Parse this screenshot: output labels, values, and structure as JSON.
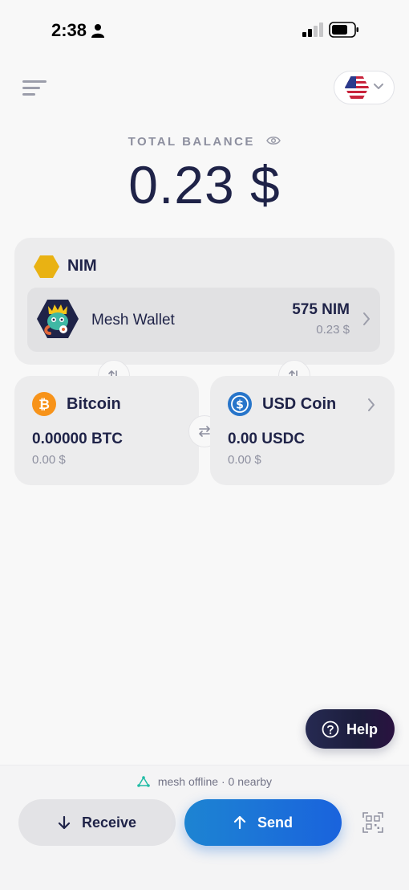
{
  "status_bar": {
    "time": "2:38",
    "icons": [
      "person-icon",
      "signal-icon",
      "battery-icon"
    ]
  },
  "header": {
    "menu_icon": "hamburger-menu-icon",
    "language_flag": "us-flag-icon",
    "language_chevron": "chevron-down-icon"
  },
  "balance": {
    "label": "TOTAL BALANCE",
    "value": "0.23 $",
    "eye_icon": "eye-icon"
  },
  "nim_account": {
    "title": "NIM",
    "wallet": {
      "name": "Mesh Wallet",
      "amount": "575 NIM",
      "fiat": "0.23 $"
    }
  },
  "assets": [
    {
      "title": "Bitcoin",
      "amount": "0.00000 BTC",
      "fiat": "0.00 $",
      "icon": "bitcoin-icon"
    },
    {
      "title": "USD Coin",
      "amount": "0.00 USDC",
      "fiat": "0.00 $",
      "icon": "usdc-icon"
    }
  ],
  "help": {
    "label": "Help"
  },
  "footer": {
    "mesh_status": "mesh offline · 0 nearby",
    "receive_label": "Receive",
    "send_label": "Send"
  },
  "colors": {
    "primary_dark": "#1f2348",
    "nim_gold": "#e9b213",
    "bitcoin_orange": "#f7931a",
    "usdc_blue": "#2775ca",
    "send_blue": "#1a73d8",
    "mesh_green": "#21bca5",
    "muted_text": "#8d8f9f"
  }
}
